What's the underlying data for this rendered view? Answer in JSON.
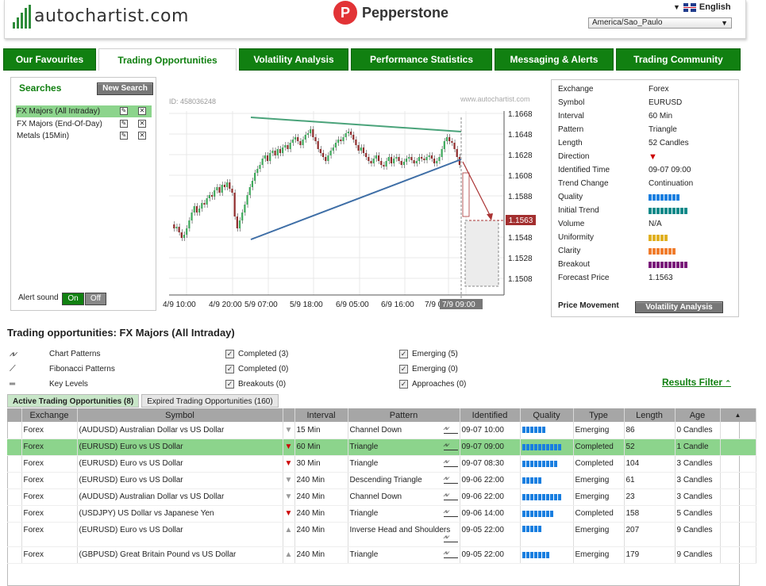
{
  "header": {
    "logo_text": "autochartist.com",
    "partner": "Pepperstone",
    "language": "English",
    "timezone": "America/Sao_Paulo"
  },
  "tabs": [
    "Our Favourites",
    "Trading Opportunities",
    "Volatility Analysis",
    "Performance Statistics",
    "Messaging & Alerts",
    "Trading Community"
  ],
  "searches": {
    "title": "Searches",
    "new_search": "New Search",
    "items": [
      "FX Majors (All Intraday)",
      "FX Majors (End-Of-Day)",
      "Metals (15Min)"
    ],
    "alert_sound_label": "Alert sound",
    "on": "On",
    "off": "Off"
  },
  "chart": {
    "id_label": "ID: 458036248",
    "watermark": "www.autochartist.com",
    "y_ticks": [
      "1.1668",
      "1.1648",
      "1.1628",
      "1.1608",
      "1.1588",
      "1.1563",
      "1.1548",
      "1.1528",
      "1.1508"
    ],
    "x_ticks": [
      "4/9 10:00",
      "4/9 20:00",
      "5/9 07:00",
      "5/9 18:00",
      "6/9 05:00",
      "6/9 16:00",
      "7/9 0",
      "7/9 09:00"
    ],
    "current_price": "1.1563"
  },
  "info": {
    "rows": [
      {
        "k": "Exchange",
        "v": "Forex"
      },
      {
        "k": "Symbol",
        "v": "EURUSD"
      },
      {
        "k": "Interval",
        "v": "60 Min"
      },
      {
        "k": "Pattern",
        "v": "Triangle"
      },
      {
        "k": "Length",
        "v": "52 Candles"
      },
      {
        "k": "Direction",
        "v": "▼"
      },
      {
        "k": "Identified Time",
        "v": "09-07 09:00"
      },
      {
        "k": "Trend Change",
        "v": "Continuation"
      },
      {
        "k": "Quality",
        "v": ""
      },
      {
        "k": "Initial Trend",
        "v": ""
      },
      {
        "k": "Volume",
        "v": "N/A"
      },
      {
        "k": "Uniformity",
        "v": ""
      },
      {
        "k": "Clarity",
        "v": ""
      },
      {
        "k": "Breakout",
        "v": ""
      },
      {
        "k": "Forecast Price",
        "v": "1.1563"
      }
    ],
    "gauges": {
      "quality": {
        "level": 8,
        "color": "#1a7fe0"
      },
      "initial_trend": {
        "level": 10,
        "color": "#138a8a"
      },
      "uniformity": {
        "level": 5,
        "color": "#e0b020"
      },
      "clarity": {
        "level": 7,
        "color": "#f07c2c"
      },
      "breakout": {
        "level": 10,
        "color": "#7a1a7a"
      }
    },
    "price_movement": "Price Movement",
    "volatility_btn": "Volatility Analysis"
  },
  "opportunities": {
    "title": "Trading opportunities: FX Majors (All Intraday)",
    "legend": [
      "Chart Patterns",
      "Fibonacci Patterns",
      "Key Levels"
    ],
    "filters_mid": [
      "Completed (3)",
      "Completed (0)",
      "Breakouts (0)"
    ],
    "filters_right": [
      "Emerging (5)",
      "Emerging (0)",
      "Approaches (0)"
    ],
    "results_filter": "Results Filter",
    "subtabs": [
      "Active Trading Opportunities (8)",
      "Expired Trading Opportunities (160)"
    ],
    "columns": [
      "Exchange",
      "Symbol",
      "Interval",
      "Pattern",
      "Identified",
      "Quality",
      "Type",
      "Length",
      "Age"
    ],
    "rows": [
      {
        "ex": "Forex",
        "sym": "(AUDUSD) Australian Dollar vs US Dollar",
        "dir": "▼",
        "dir_color": "#999",
        "int": "15 Min",
        "pat": "Channel Down",
        "id": "09-07 10:00",
        "q": 6,
        "type": "Emerging",
        "len": "86",
        "age": "0 Candles"
      },
      {
        "ex": "Forex",
        "sym": "(EURUSD) Euro vs US Dollar",
        "dir": "▼",
        "dir_color": "#cc0000",
        "int": "60 Min",
        "pat": "Triangle",
        "id": "09-07 09:00",
        "q": 10,
        "type": "Completed",
        "len": "52",
        "age": "1 Candle"
      },
      {
        "ex": "Forex",
        "sym": "(EURUSD) Euro vs US Dollar",
        "dir": "▼",
        "dir_color": "#cc0000",
        "int": "30 Min",
        "pat": "Triangle",
        "id": "09-07 08:30",
        "q": 9,
        "type": "Completed",
        "len": "104",
        "age": "3 Candles"
      },
      {
        "ex": "Forex",
        "sym": "(EURUSD) Euro vs US Dollar",
        "dir": "▼",
        "dir_color": "#999",
        "int": "240 Min",
        "pat": "Descending Triangle",
        "id": "09-06 22:00",
        "q": 5,
        "type": "Emerging",
        "len": "61",
        "age": "3 Candles"
      },
      {
        "ex": "Forex",
        "sym": "(AUDUSD) Australian Dollar vs US Dollar",
        "dir": "▼",
        "dir_color": "#999",
        "int": "240 Min",
        "pat": "Channel Down",
        "id": "09-06 22:00",
        "q": 10,
        "type": "Emerging",
        "len": "23",
        "age": "3 Candles"
      },
      {
        "ex": "Forex",
        "sym": "(USDJPY) US Dollar vs Japanese Yen",
        "dir": "▼",
        "dir_color": "#cc0000",
        "int": "240 Min",
        "pat": "Triangle",
        "id": "09-06 14:00",
        "q": 8,
        "type": "Completed",
        "len": "158",
        "age": "5 Candles"
      },
      {
        "ex": "Forex",
        "sym": "(EURUSD) Euro vs US Dollar",
        "dir": "▲",
        "dir_color": "#999",
        "int": "240 Min",
        "pat": "Inverse Head and Shoulders",
        "id": "09-05 22:00",
        "q": 5,
        "type": "Emerging",
        "len": "207",
        "age": "9 Candles"
      },
      {
        "ex": "Forex",
        "sym": "(GBPUSD) Great Britain Pound vs US Dollar",
        "dir": "▲",
        "dir_color": "#999",
        "int": "240 Min",
        "pat": "Triangle",
        "id": "09-05 22:00",
        "q": 7,
        "type": "Emerging",
        "len": "179",
        "age": "9 Candles"
      }
    ]
  }
}
